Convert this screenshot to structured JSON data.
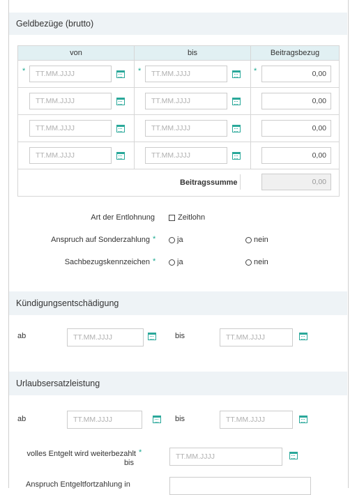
{
  "geld": {
    "title": "Geldbezüge (brutto)",
    "col_von": "von",
    "col_bis": "bis",
    "col_beitrag": "Beitragsbezug",
    "date_placeholder": "TT.MM.JJJJ",
    "rows": [
      {
        "value": "0,00"
      },
      {
        "value": "0,00"
      },
      {
        "value": "0,00"
      },
      {
        "value": "0,00"
      }
    ],
    "sum_label": "Beitragssumme",
    "sum_value": "0,00"
  },
  "options": {
    "art_label": "Art der Entlohnung",
    "zeitlohn_label": "Zeitlohn",
    "sonder_label": "Anspruch auf Sonderzahlung",
    "sachbezug_label": "Sachbezugskennzeichen",
    "ja": "ja",
    "nein": "nein"
  },
  "kuendigung": {
    "title": "Kündigungsentschädigung",
    "ab": "ab",
    "bis": "bis",
    "placeholder": "TT.MM.JJJJ"
  },
  "urlaub": {
    "title": "Urlaubsersatzleistung",
    "ab": "ab",
    "bis": "bis",
    "placeholder": "TT.MM.JJJJ",
    "volles_label": "volles Entgelt wird weiterbezahlt",
    "volles_bis": "bis",
    "anspruch_label": "Anspruch Entgeltfortzahlung in"
  },
  "colors": {
    "accent": "#1aa88f",
    "header_bg": "#eef3f6",
    "table_header_bg": "#e1f0f3"
  },
  "icons": {
    "calendar": "calendar-icon",
    "required": "required-asterisk"
  }
}
